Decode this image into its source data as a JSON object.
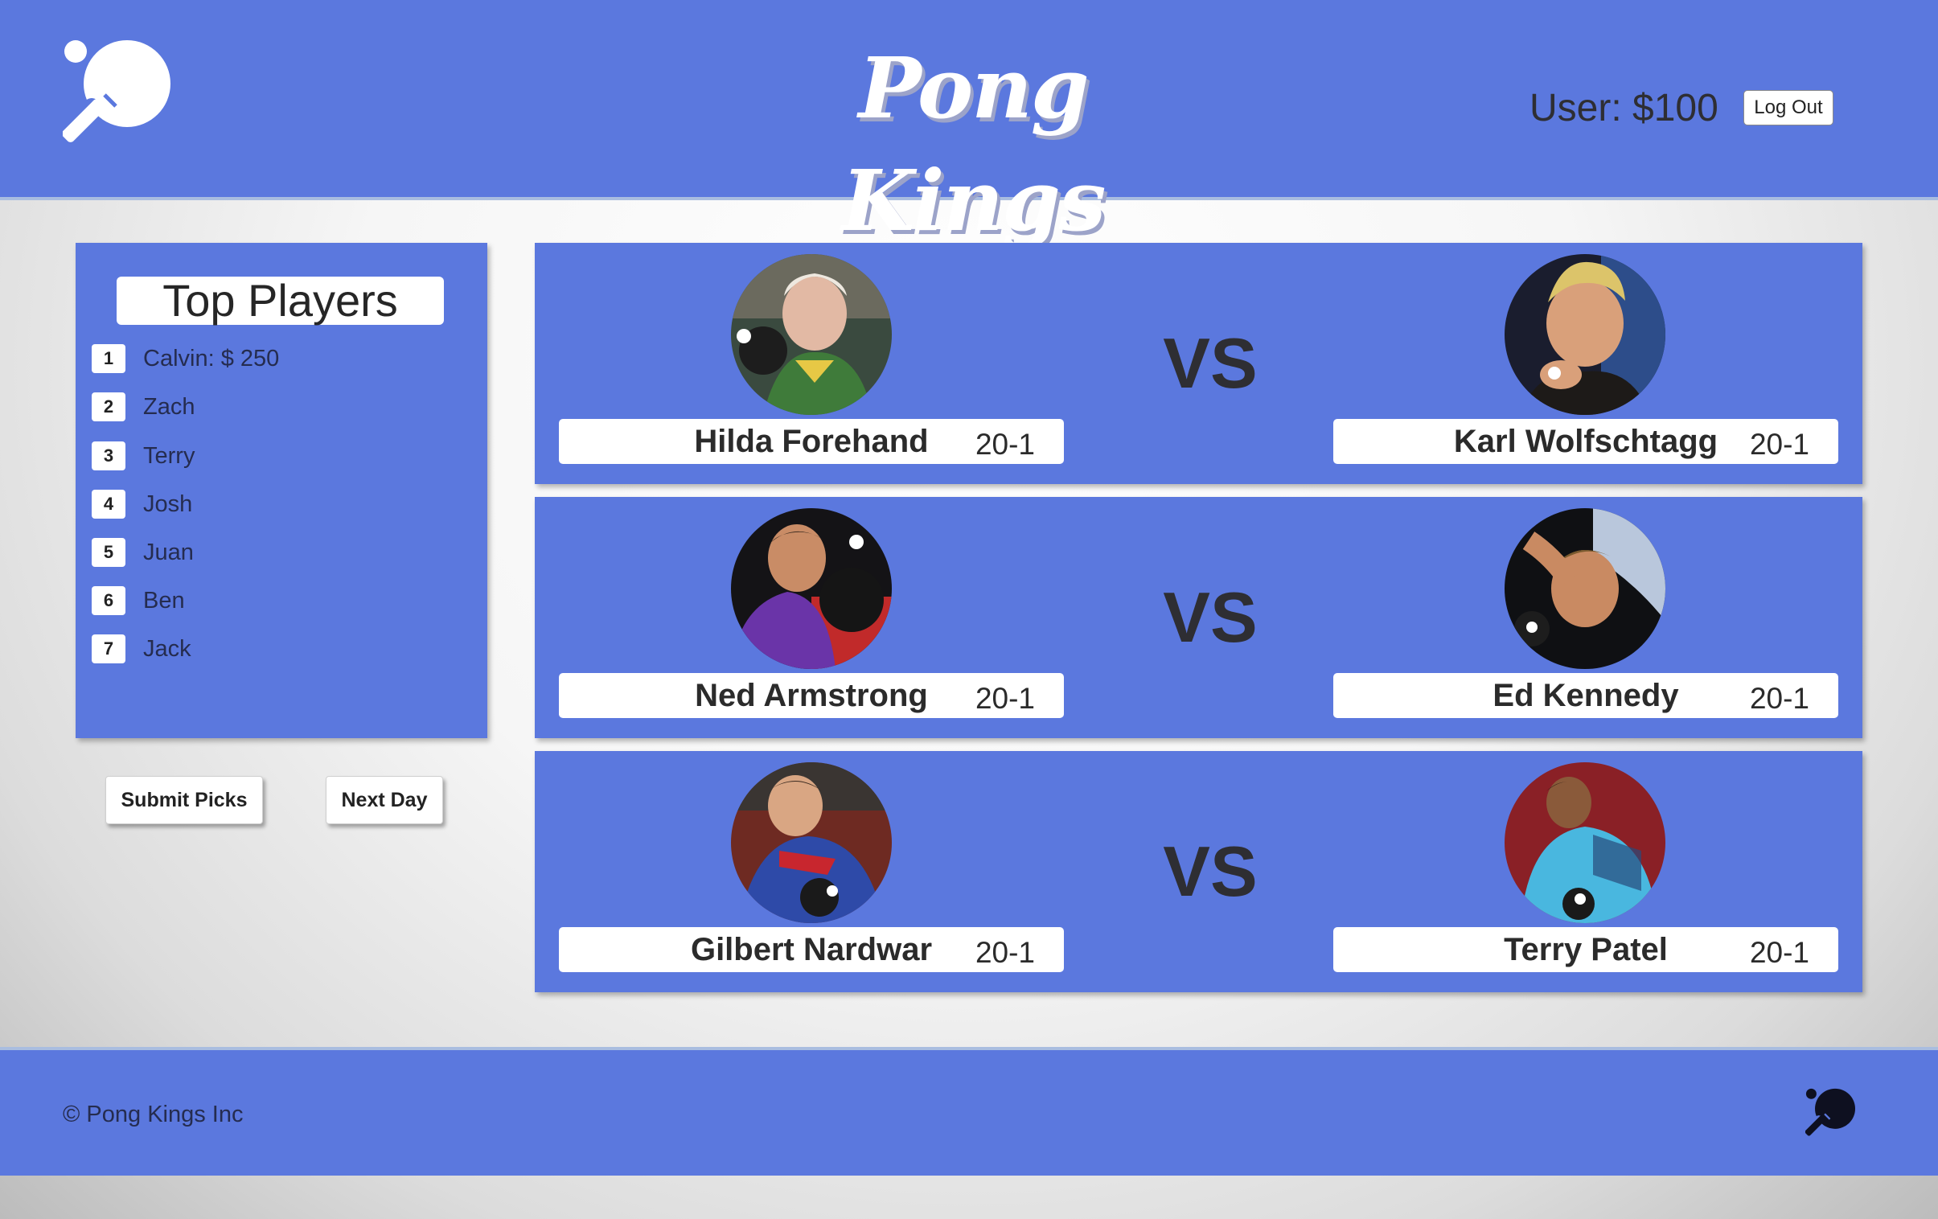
{
  "header": {
    "logo_icon": "ping-pong-paddle-icon",
    "title": "Pong Kings",
    "user_balance": "User: $100",
    "logout_label": "Log Out"
  },
  "leaderboard": {
    "title": "Top Players",
    "entries": [
      {
        "rank": "1",
        "name": "Calvin: $ 250"
      },
      {
        "rank": "2",
        "name": "Zach"
      },
      {
        "rank": "3",
        "name": "Terry"
      },
      {
        "rank": "4",
        "name": "Josh"
      },
      {
        "rank": "5",
        "name": "Juan"
      },
      {
        "rank": "6",
        "name": "Ben"
      },
      {
        "rank": "7",
        "name": "Jack"
      }
    ]
  },
  "actions": {
    "submit_label": "Submit Picks",
    "next_label": "Next Day"
  },
  "matches": [
    {
      "vs": "VS",
      "left": {
        "name": "Hilda Forehand",
        "odds": "20-1"
      },
      "right": {
        "name": "Karl Wolfschtagg",
        "odds": "20-1"
      }
    },
    {
      "vs": "VS",
      "left": {
        "name": "Ned Armstrong",
        "odds": "20-1"
      },
      "right": {
        "name": "Ed Kennedy",
        "odds": "20-1"
      }
    },
    {
      "vs": "VS",
      "left": {
        "name": "Gilbert Nardwar",
        "odds": "20-1"
      },
      "right": {
        "name": "Terry Patel",
        "odds": "20-1"
      }
    }
  ],
  "footer": {
    "copyright": "© Pong Kings Inc",
    "logo_icon": "ping-pong-paddle-icon"
  },
  "colors": {
    "brand_blue": "#5b78de",
    "divider": "#a9bde0",
    "text_dark": "#2e2e33"
  }
}
